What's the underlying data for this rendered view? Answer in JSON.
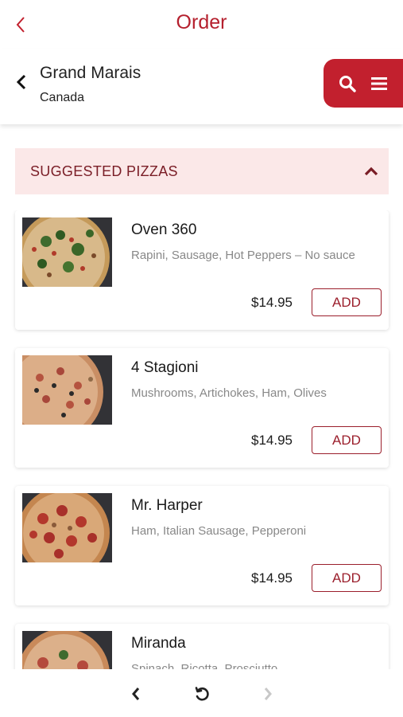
{
  "header": {
    "title": "Order"
  },
  "location": {
    "city": "Grand Marais",
    "country": "Canada"
  },
  "section": {
    "title": "SUGGESTED PIZZAS"
  },
  "menu": {
    "add_label": "ADD",
    "items": [
      {
        "name": "Oven 360",
        "description": "Rapini, Sausage, Hot Peppers – No sauce",
        "price": "$14.95"
      },
      {
        "name": "4 Stagioni",
        "description": "Mushrooms, Artichokes, Ham, Olives",
        "price": "$14.95"
      },
      {
        "name": "Mr. Harper",
        "description": "Ham, Italian Sausage, Pepperoni",
        "price": "$14.95"
      },
      {
        "name": "Miranda",
        "description": "Spinach, Ricotta, Prosciutto",
        "price": ""
      }
    ]
  },
  "colors": {
    "brand": "#c2202e",
    "brand_dark": "#9b1f2c",
    "section_bg": "#fbe8e8"
  },
  "icons": {
    "top_back": "chevron-left-icon",
    "location_back": "chevron-left-icon",
    "search": "search-icon",
    "menu": "hamburger-menu-icon",
    "section_toggle": "chevron-up-icon",
    "nav_back": "chevron-left-icon",
    "nav_reload": "reload-icon",
    "nav_forward": "chevron-right-icon"
  }
}
